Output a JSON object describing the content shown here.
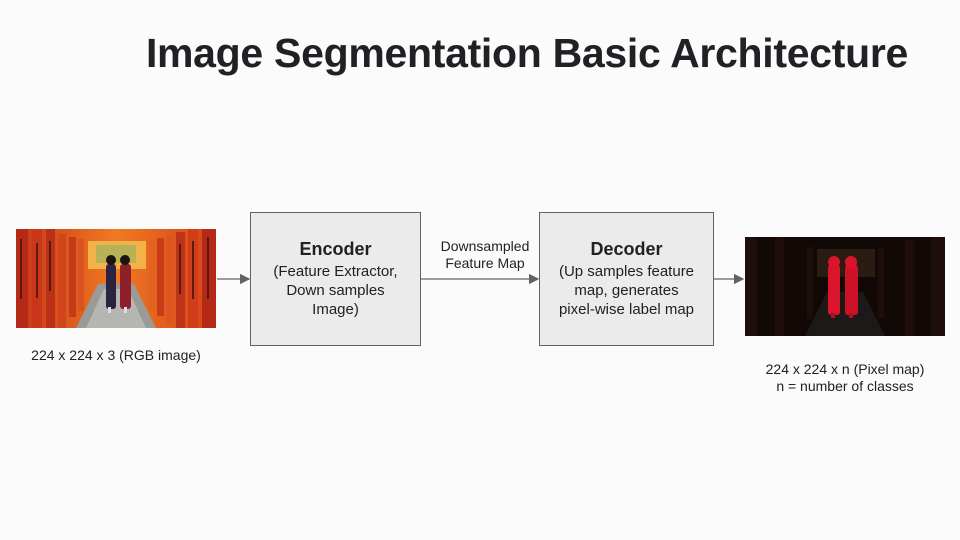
{
  "title": "Image Segmentation Basic Architecture",
  "input": {
    "caption": "224 x 224 x 3 (RGB image)"
  },
  "encoder": {
    "title": "Encoder",
    "lines": [
      "(Feature Extractor,",
      "Down samples",
      "Image)"
    ]
  },
  "connector": {
    "lines": [
      "Downsampled",
      "Feature Map"
    ]
  },
  "decoder": {
    "title": "Decoder",
    "lines": [
      "(Up samples feature",
      "map, generates",
      "pixel-wise label map"
    ]
  },
  "output": {
    "caption_lines": [
      "224 x 224 x n (Pixel map)",
      "n = number of classes"
    ]
  },
  "colors": {
    "block_fill": "#ebebeb",
    "block_border": "#5f6368",
    "arrow": "#5f6368",
    "torii_orange": "#e8511d",
    "segment_red": "#d9142b"
  }
}
